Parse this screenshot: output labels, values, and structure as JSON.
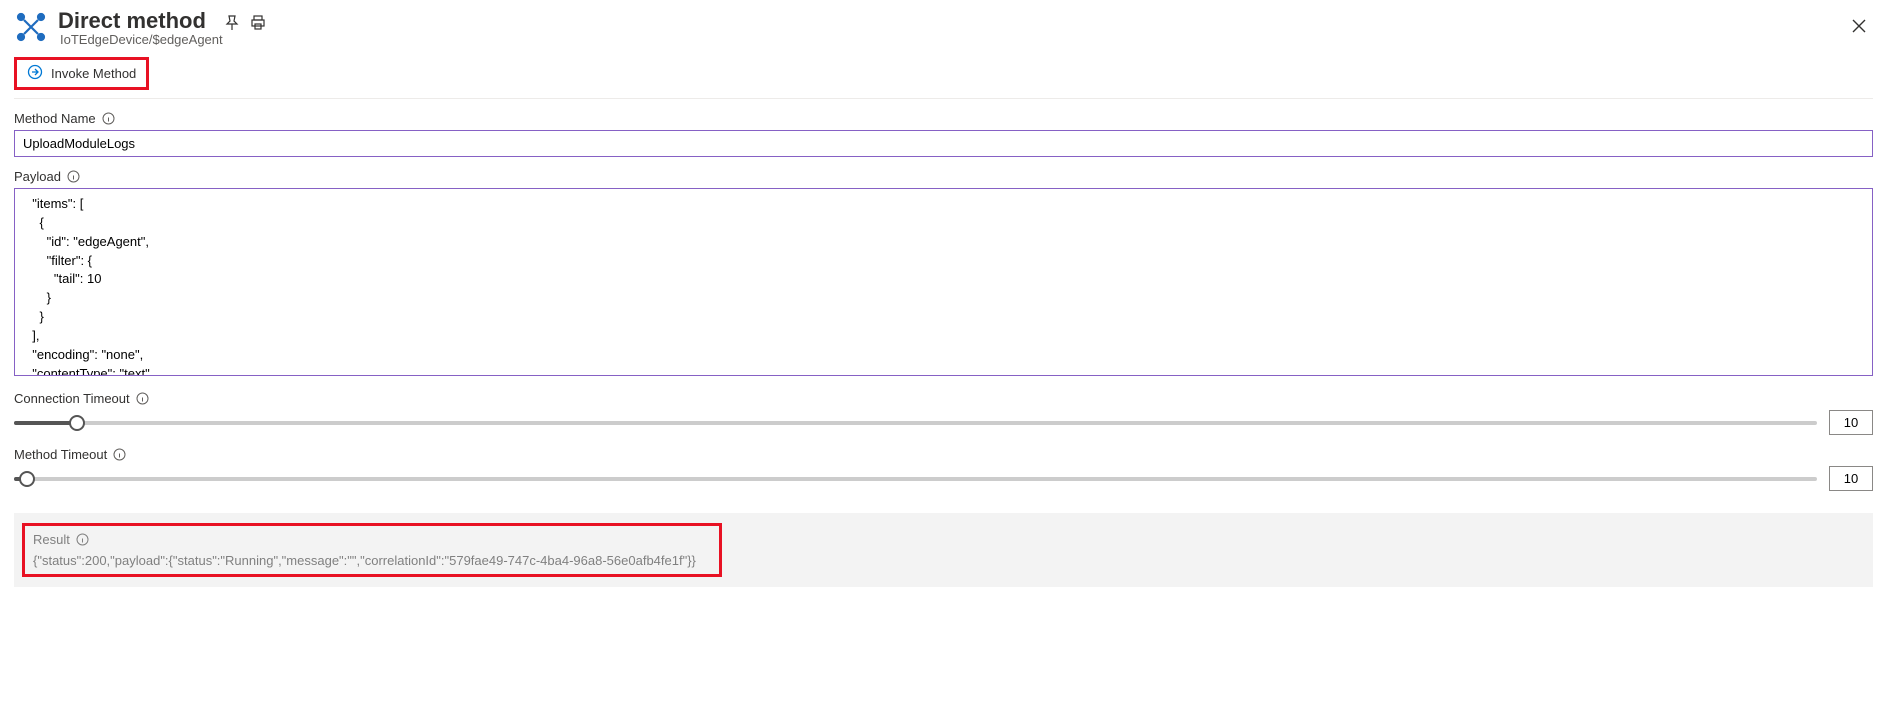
{
  "header": {
    "title": "Direct method",
    "breadcrumb": "IoTEdgeDevice/$edgeAgent"
  },
  "toolbar": {
    "invoke_label": "Invoke Method"
  },
  "methodName": {
    "label": "Method Name",
    "value": "UploadModuleLogs"
  },
  "payload": {
    "label": "Payload",
    "value": "  \"items\": [\n    {\n      \"id\": \"edgeAgent\",\n      \"filter\": {\n        \"tail\": 10\n      }\n    }\n  ],\n  \"encoding\": \"none\",\n  \"contentType\": \"text\""
  },
  "connectionTimeout": {
    "label": "Connection Timeout",
    "value": "10",
    "fillPercent": 3.5
  },
  "methodTimeout": {
    "label": "Method Timeout",
    "value": "10",
    "fillPercent": 0.7
  },
  "result": {
    "label": "Result",
    "value": "{\"status\":200,\"payload\":{\"status\":\"Running\",\"message\":\"\",\"correlationId\":\"579fae49-747c-4ba4-96a8-56e0afb4fe1f\"}}"
  }
}
